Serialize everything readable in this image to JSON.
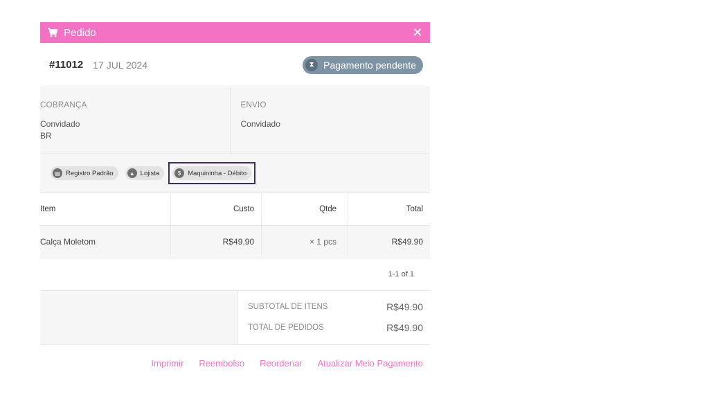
{
  "window": {
    "title": "Pedido",
    "close_icon": "close-icon",
    "cart_icon": "cart-icon"
  },
  "order": {
    "number": "#11012",
    "date": "17 JUL 2024",
    "status": "Pagamento pendente",
    "status_icon": "hourglass-icon"
  },
  "billing": {
    "heading": "COBRANÇA",
    "name": "Convidado",
    "country": "BR"
  },
  "shipping": {
    "heading": "ENVIO",
    "name": "Convidado"
  },
  "chips": [
    {
      "label": "Registro Padrão",
      "icon": "register-icon"
    },
    {
      "label": "Lojista",
      "icon": "store-icon"
    },
    {
      "label": "Maquininha - Débito",
      "icon": "card-icon"
    }
  ],
  "table": {
    "headers": {
      "item": "Item",
      "cost": "Custo",
      "qty": "Qtde",
      "total": "Total"
    },
    "rows": [
      {
        "item": "Calça Moletom",
        "cost": "R$49.90",
        "qty": "× 1 pcs",
        "total": "R$49.90"
      }
    ],
    "pager": "1-1 of 1"
  },
  "totals": {
    "subtotal_label": "SUBTOTAL DE ITENS",
    "subtotal_value": "R$49.90",
    "total_label": "TOTAL DE PEDIDOS",
    "total_value": "R$49.90"
  },
  "actions": {
    "print": "Imprimir",
    "refund": "Reembolso",
    "reorder": "Reordenar",
    "update_payment": "Atualizar Meio Pagamento"
  },
  "colors": {
    "accent": "#f472c4",
    "status_bg": "#7e93a4",
    "highlight_border": "#3d2e58"
  }
}
